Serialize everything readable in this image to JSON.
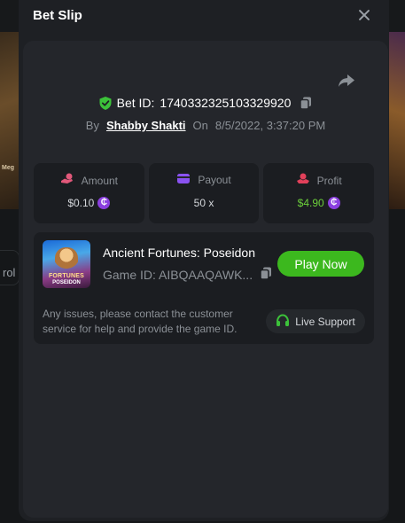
{
  "background": {
    "mega_label": "Meg",
    "rol_label": "rol"
  },
  "modal": {
    "title": "Bet Slip"
  },
  "bet": {
    "bet_id_label": "Bet ID:",
    "bet_id": "1740332325103329920",
    "by_label": "By",
    "username": "Shabby Shakti",
    "on_label": "On",
    "datetime": "8/5/2022, 3:37:20 PM"
  },
  "stats": {
    "amount": {
      "label": "Amount",
      "value": "$0.10",
      "icon": "hand-coin-icon"
    },
    "payout": {
      "label": "Payout",
      "value": "50 x",
      "icon": "wallet-icon"
    },
    "profit": {
      "label": "Profit",
      "value": "$4.90",
      "icon": "hand-coin-icon"
    }
  },
  "currency": {
    "symbol": "₵",
    "color": "#8b3fe0"
  },
  "game": {
    "title": "Ancient Fortunes: Poseidon",
    "id_label": "Game ID: AIBQAAQAWK...",
    "thumb_text_line1": "FORTUNES",
    "thumb_text_line2": "POSEIDON",
    "play_label": "Play Now"
  },
  "support": {
    "issue_text": "Any issues, please contact the customer service for help and provide the game ID.",
    "button_label": "Live Support"
  },
  "colors": {
    "accent_green": "#3cb81e",
    "profit_green": "#6ccf3b",
    "coin_purple": "#8b3fe0",
    "shield_green": "#3cc23a",
    "amount_pink": "#e2587a",
    "payout_purple": "#8a52f0",
    "profit_red": "#e2405a"
  }
}
